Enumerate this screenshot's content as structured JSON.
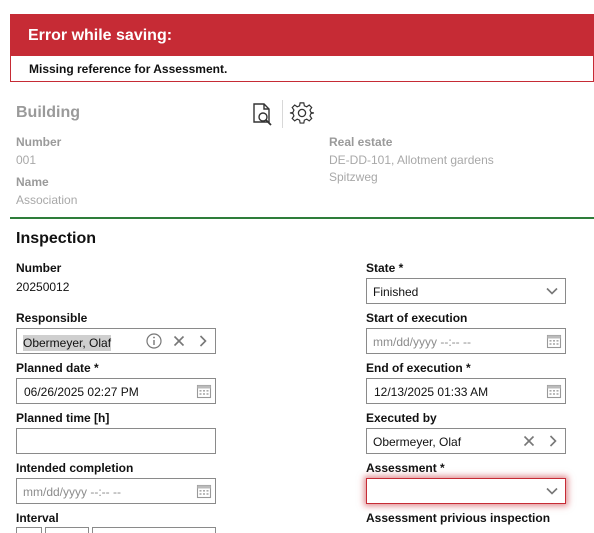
{
  "error": {
    "title": "Error while saving:",
    "message": "Missing reference for Assessment."
  },
  "building": {
    "title": "Building",
    "toolbar": {
      "icons": [
        "document-search-icon",
        "gear-icon"
      ]
    },
    "number_label": "Number",
    "number_value": "001",
    "name_label": "Name",
    "name_value": "Association",
    "real_estate_label": "Real estate",
    "real_estate_value_line1": "DE-DD-101, Allotment gardens",
    "real_estate_value_line2": "Spitzweg"
  },
  "inspection": {
    "title": "Inspection",
    "number_label": "Number",
    "number_value": "20250012",
    "state_label": "State *",
    "state_value": "Finished",
    "responsible_label": "Responsible",
    "responsible_value": "Obermeyer, Olaf",
    "start_label": "Start of execution",
    "start_placeholder": "mm/dd/yyyy --:-- --",
    "planned_date_label": "Planned date *",
    "planned_date_value": "06/26/2025 02:27  PM",
    "end_label": "End of execution *",
    "end_value": "12/13/2025 01:33  AM",
    "planned_time_label": "Planned time [h]",
    "planned_time_value": "",
    "executed_by_label": "Executed by",
    "executed_by_value": "Obermeyer, Olaf",
    "intended_label": "Intended completion",
    "intended_placeholder": "mm/dd/yyyy --:-- --",
    "assessment_label": "Assessment *",
    "assessment_value": "",
    "interval_label": "Interval",
    "prev_assessment_label": "Assessment privious inspection"
  },
  "colors": {
    "error_red": "#c62b35",
    "section_green": "#2e7d3a",
    "muted_text": "#9a9a9a"
  }
}
